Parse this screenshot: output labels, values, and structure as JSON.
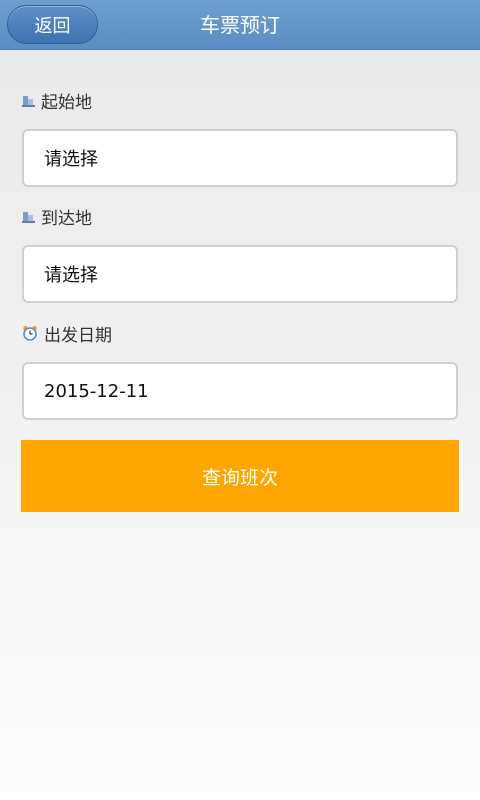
{
  "header": {
    "back_label": "返回",
    "title": "车票预订"
  },
  "form": {
    "origin": {
      "label": "起始地",
      "value": "请选择",
      "icon": "city-icon"
    },
    "destination": {
      "label": "到达地",
      "value": "请选择",
      "icon": "city-icon"
    },
    "date": {
      "label": "出发日期",
      "value": "2015-12-11",
      "icon": "alarm-clock-icon"
    }
  },
  "actions": {
    "query_label": "查询班次",
    "query_color": "#ffa500"
  },
  "colors": {
    "header": "#5b8dc3",
    "header_button": "#3f73b0"
  }
}
